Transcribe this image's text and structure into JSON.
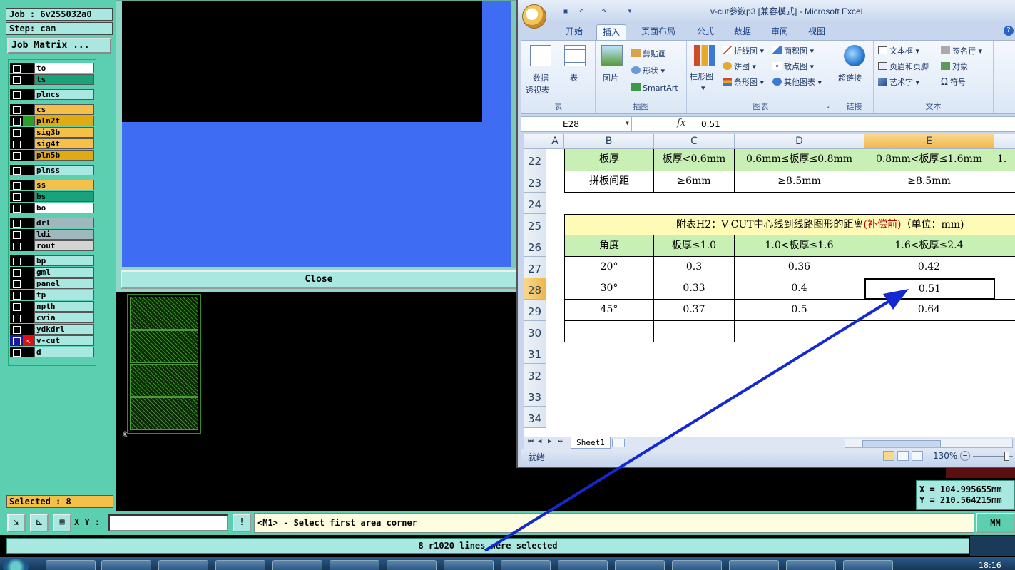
{
  "cam": {
    "job_label": "Job : 6v255032a0",
    "step_label": "Step: cam",
    "job_matrix_button": "Job Matrix ...",
    "layers": [
      {
        "name": "to",
        "color": "#ffffff"
      },
      {
        "name": "ts",
        "color": "#1aa37a"
      },
      {
        "name": "plncs",
        "color": "#a8e8e0"
      },
      {
        "name": "cs",
        "color": "#f5c04a"
      },
      {
        "name": "pln2t",
        "color": "#e0aa14"
      },
      {
        "name": "sig3b",
        "color": "#f5c04a"
      },
      {
        "name": "sig4t",
        "color": "#f5c04a"
      },
      {
        "name": "pln5b",
        "color": "#e0aa14"
      },
      {
        "name": "plnss",
        "color": "#a8e8e0"
      },
      {
        "name": "ss",
        "color": "#f5c04a"
      },
      {
        "name": "bs",
        "color": "#1aa37a"
      },
      {
        "name": "bo",
        "color": "#ffffff"
      },
      {
        "name": "drl",
        "color": "#9fb8bd"
      },
      {
        "name": "ldi",
        "color": "#9fb8bd"
      },
      {
        "name": "rout",
        "color": "#d4d4d4"
      },
      {
        "name": "bp",
        "color": "#a8e8e0"
      },
      {
        "name": "gml",
        "color": "#a8e8e0"
      },
      {
        "name": "panel",
        "color": "#a8e8e0"
      },
      {
        "name": "tp",
        "color": "#a8e8e0"
      },
      {
        "name": "npth",
        "color": "#a8e8e0"
      },
      {
        "name": "cvia",
        "color": "#a8e8e0"
      },
      {
        "name": "ydkdrl",
        "color": "#a8e8e0"
      },
      {
        "name": "v-cut",
        "color": "#a8e8e0"
      },
      {
        "name": "d",
        "color": "#a8e8e0"
      }
    ],
    "selected_label": "Selected : 8",
    "close_button": "Close",
    "xy_label": "X Y :",
    "xy_value": "",
    "prompt": "<M1> - Select first area corner",
    "unit": "MM",
    "coord_x": "X = 104.995655mm",
    "coord_y": "Y = 210.564215mm",
    "message": "8 r1020 lines were selected",
    "clock": "18:16"
  },
  "excel": {
    "title": "v-cut参数p3  [兼容模式] - Microsoft Excel",
    "tabs": [
      "开始",
      "插入",
      "页面布局",
      "公式",
      "数据",
      "审阅",
      "视图"
    ],
    "active_tab": "插入",
    "ribbon": {
      "pivot_label_1": "数据",
      "pivot_label_2": "透视表",
      "table_label": "表",
      "picture_label": "图片",
      "clipart_label": "剪贴画",
      "shapes_label": "形状",
      "smartart_label": "SmartArt",
      "column_chart_label": "柱形图",
      "line_chart_label": "折线图",
      "pie_chart_label": "饼图",
      "bar_chart_label": "条形图",
      "area_chart_label": "面积图",
      "scatter_chart_label": "散点图",
      "other_chart_label": "其他图表",
      "hyperlink_label": "超链接",
      "textbox_label": "文本框",
      "header_footer_label": "页眉和页脚",
      "wordart_label": "艺术字",
      "signature_label": "签名行",
      "object_label": "对象",
      "symbol_label": "符号",
      "groups": {
        "tables": "表",
        "illustrations": "插图",
        "charts": "图表",
        "links": "链接",
        "text": "文本"
      }
    },
    "name_box": "E28",
    "formula_value": "0.51",
    "columns": [
      "A",
      "B",
      "C",
      "D",
      "E"
    ],
    "extra_col_fragment": "1.",
    "rows": {
      "r22": {
        "num": "22",
        "b": "板厚",
        "c": "板厚<0.6mm",
        "d": "0.6mm≤板厚≤0.8mm",
        "e": "0.8mm<板厚≤1.6mm"
      },
      "r23": {
        "num": "23",
        "b": "拼板间距",
        "c": "≥6mm",
        "d": "≥8.5mm",
        "e": "≥8.5mm"
      },
      "r24": {
        "num": "24"
      },
      "r25": {
        "num": "25",
        "title_main": "附表H2：V-CUT中心线到线路图形的距离",
        "title_red": "(补偿前)",
        "title_tail": "（单位：mm)"
      },
      "r26": {
        "num": "26",
        "b": "角度",
        "c": "板厚≤1.0",
        "d": "1.0<板厚≤1.6",
        "e": "1.6<板厚≤2.4"
      },
      "r27": {
        "num": "27",
        "b": "20°",
        "c": "0.3",
        "d": "0.36",
        "e": "0.42"
      },
      "r28": {
        "num": "28",
        "b": "30°",
        "c": "0.33",
        "d": "0.4",
        "e": "0.51"
      },
      "r29": {
        "num": "29",
        "b": "45°",
        "c": "0.37",
        "d": "0.5",
        "e": "0.64"
      },
      "r30": {
        "num": "30"
      },
      "r31": {
        "num": "31"
      },
      "r32": {
        "num": "32"
      },
      "r33": {
        "num": "33"
      },
      "r34": {
        "num": "34"
      }
    },
    "sheet_tab": "Sheet1",
    "status": "就绪",
    "zoom": "130%"
  },
  "colors": {
    "cam_bg": "#5ccfb0",
    "cam_blue": "#3e6cf2",
    "cell_green": "#c8f0b4",
    "cell_yellow": "#fdfbb6",
    "arrow": "#1428d2"
  },
  "icons": [
    "office-button-icon",
    "save-icon",
    "undo-icon",
    "redo-icon",
    "help-icon",
    "fx-icon",
    "origin-icon"
  ]
}
